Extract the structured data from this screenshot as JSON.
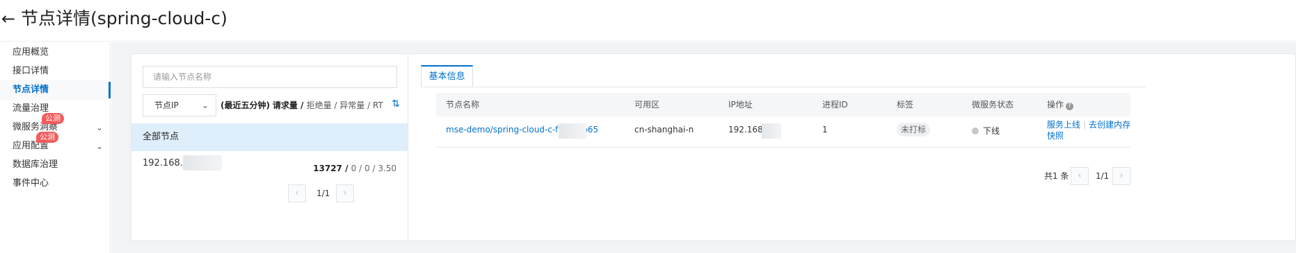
{
  "header": {
    "back_icon": "←",
    "title": "节点详情(spring-cloud-c)"
  },
  "sidebar": {
    "items": [
      {
        "label": "应用概览"
      },
      {
        "label": "接口详情"
      },
      {
        "label": "节点详情",
        "active": true
      },
      {
        "label": "流量治理"
      },
      {
        "label": "微服务洞察",
        "badge": "公测"
      },
      {
        "label": "应用配置",
        "badge": "公测"
      },
      {
        "label": "数据库治理"
      },
      {
        "label": "事件中心"
      }
    ]
  },
  "left_panel": {
    "search_placeholder": "请输入节点名称",
    "select_value": "节点IP",
    "metrics_prefix": "(最近五分钟)",
    "metric_request": "请求量",
    "metric_rest": "拒绝量 / 异常量 / RT",
    "all_nodes": "全部节点",
    "node_ip": "192.168.",
    "node_request": "13727",
    "node_stats_rest": "0 / 0 / 3.50",
    "pagination": "1/1"
  },
  "right_panel": {
    "tab": "基本信息",
    "columns": [
      "节点名称",
      "可用区",
      "IP地址",
      "进程ID",
      "标签",
      "微服务状态",
      "操作"
    ],
    "row": {
      "node_name": "mse-demo/spring-cloud-c-f58f97b65",
      "zone": "cn-shanghai-n",
      "ip": "192.168.",
      "pid": "1",
      "tag": "未打标",
      "status": "下线",
      "action_online": "服务上线",
      "action_snapshot_1": "去创建内存",
      "action_snapshot_2": "快照"
    },
    "total": "共1 条",
    "pagination": "1/1"
  },
  "colors": {
    "accent": "#0070cc",
    "badge": "#f25c5c",
    "selected_bg": "#dfeefb"
  }
}
